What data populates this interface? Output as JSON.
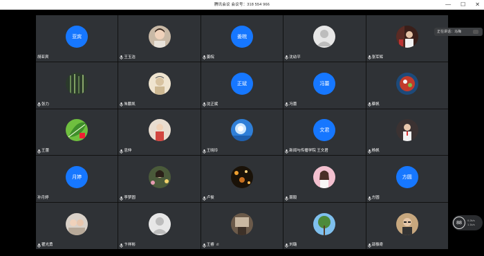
{
  "window": {
    "title": "腾讯会议  会议号：318 554 966",
    "controls": {
      "minimize": "—",
      "maximize": "☐",
      "close": "✕"
    }
  },
  "speaking": {
    "label": "正在讲话：马梅"
  },
  "network": {
    "value": "88",
    "unit": "",
    "up": "0.2k/s",
    "down": "1.1k/s"
  },
  "colors": {
    "accent": "#1677ff",
    "tile_bg": "#2f3236",
    "background": "#000000"
  },
  "participants": [
    {
      "name": "胡亚宾",
      "avatar_text": "亚宾",
      "type": "text",
      "mic": false
    },
    {
      "name": "王玉洁",
      "type": "photo",
      "photo": "person-boy",
      "mic": true
    },
    {
      "name": "姜皖",
      "avatar_text": "姜皖",
      "type": "text",
      "mic": true
    },
    {
      "name": "沈幼平",
      "type": "photo",
      "photo": "default-user",
      "mic": true
    },
    {
      "name": "张军辉",
      "type": "photo",
      "photo": "person-red",
      "mic": true
    },
    {
      "name": "张力",
      "type": "photo",
      "photo": "plant-dark",
      "mic": true
    },
    {
      "name": "朱鹏凯",
      "type": "photo",
      "photo": "person-sketch",
      "mic": true
    },
    {
      "name": "沈正斌",
      "avatar_text": "正斌",
      "type": "text",
      "mic": true
    },
    {
      "name": "冯蕾",
      "avatar_text": "冯蕾",
      "type": "text",
      "mic": true
    },
    {
      "name": "蔡帆",
      "type": "photo",
      "photo": "food",
      "mic": true
    },
    {
      "name": "王蕾",
      "type": "photo",
      "photo": "leaf-green",
      "mic": true
    },
    {
      "name": "忠仲",
      "type": "photo",
      "photo": "person-red-shirt",
      "mic": true
    },
    {
      "name": "王晓玲",
      "type": "photo",
      "photo": "sky-blue",
      "mic": true
    },
    {
      "name": "新闻与传播学院 王文君",
      "avatar_text": "文君",
      "type": "text",
      "mic": true
    },
    {
      "name": "杨帆",
      "type": "photo",
      "photo": "person-dark",
      "mic": true
    },
    {
      "name": "孙月婷",
      "avatar_text": "月婷",
      "type": "text",
      "mic": false
    },
    {
      "name": "李梦圆",
      "type": "photo",
      "photo": "person-flowers",
      "mic": true
    },
    {
      "name": "卢俊",
      "type": "photo",
      "photo": "night-lights",
      "mic": true
    },
    {
      "name": "聂毅",
      "type": "photo",
      "photo": "person-pink",
      "mic": true
    },
    {
      "name": "方圆",
      "avatar_text": "方圆",
      "type": "text",
      "mic": true
    },
    {
      "name": "瞿光勇",
      "type": "photo",
      "photo": "group-photo",
      "mic": true
    },
    {
      "name": "卞祥彬",
      "type": "photo",
      "photo": "default-user",
      "mic": true
    },
    {
      "name": "王睿",
      "type": "photo",
      "photo": "room-interior",
      "mic": true,
      "signal": "ıll"
    },
    {
      "name": "刘璐",
      "type": "photo",
      "photo": "tree-sky",
      "mic": true
    },
    {
      "name": "邵振奇",
      "type": "photo",
      "photo": "person-glasses",
      "mic": true
    }
  ]
}
